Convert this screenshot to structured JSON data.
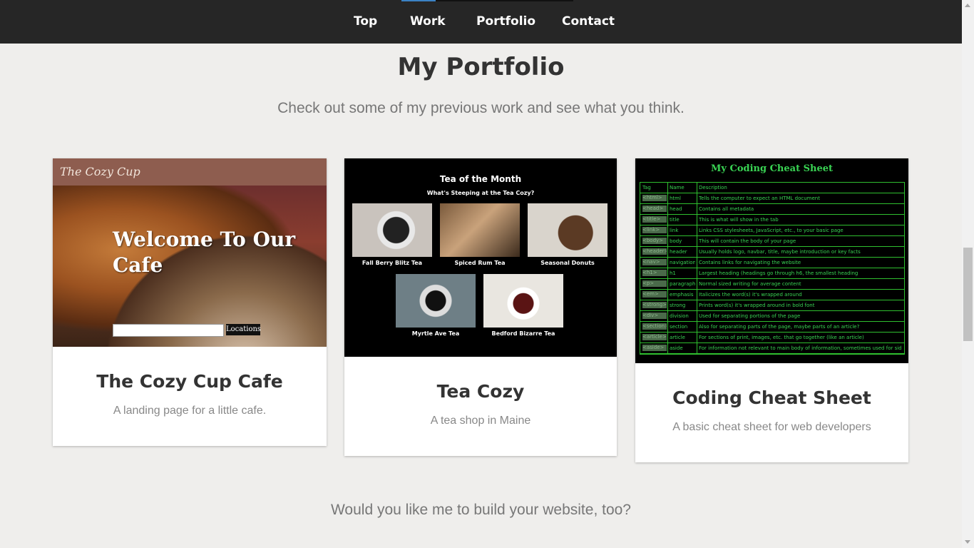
{
  "nav": {
    "items": [
      {
        "label": "Top"
      },
      {
        "label": "Work"
      },
      {
        "label": "Portfolio"
      },
      {
        "label": "Contact"
      }
    ]
  },
  "section": {
    "title": "My Portfolio",
    "subtitle": "Check out some of my previous work and see what you think."
  },
  "cards": [
    {
      "title": "The Cozy Cup Cafe",
      "description": "A landing page for a little cafe.",
      "thumb": {
        "logo": "The Cozy Cup",
        "welcome": "Welcome To Our Cafe",
        "button": "Locations"
      }
    },
    {
      "title": "Tea Cozy",
      "description": "A tea shop in Maine",
      "thumb": {
        "title": "Tea of the Month",
        "subtitle": "What's Steeping at the Tea Cozy?",
        "items": [
          "Fall Berry Blitz Tea",
          "Spiced Rum Tea",
          "Seasonal Donuts",
          "Myrtle Ave Tea",
          "Bedford Bizarre Tea"
        ]
      }
    },
    {
      "title": "Coding Cheat Sheet",
      "description": "A basic cheat sheet for web developers",
      "thumb": {
        "title": "My Coding Cheat Sheet",
        "header": [
          "Tag",
          "Name",
          "Description"
        ],
        "rows": [
          [
            "<html>",
            "html",
            "Tells the computer to expect an HTML document"
          ],
          [
            "<head>",
            "head",
            "Contains all metadata"
          ],
          [
            "<title>",
            "title",
            "This is what will show in the tab"
          ],
          [
            "<link>",
            "link",
            "Links CSS stylesheets, JavaScript, etc., to your basic page"
          ],
          [
            "<body>",
            "body",
            "This will contain the body of your page"
          ],
          [
            "<header>",
            "header",
            "Usually holds logo, navbar, title, maybe introduction or key facts"
          ],
          [
            "<nav>",
            "navigation",
            "Contains links for navigating the website"
          ],
          [
            "<h1>",
            "h1",
            "Largest heading (headings go through h6, the smallest heading"
          ],
          [
            "<p>",
            "paragraph",
            "Normal sized writing for average content"
          ],
          [
            "<em>",
            "emphasis",
            "Italicizes the word(s) it's wrapped around"
          ],
          [
            "<strong>",
            "strong",
            "Prints word(s) it's wrapped around in bold font"
          ],
          [
            "<div>",
            "division",
            "Used for separating portions of the page"
          ],
          [
            "<section>",
            "section",
            "Also for separating parts of the page, maybe parts of an article?"
          ],
          [
            "<article>",
            "article",
            "For sections of print, images, etc. that go together (like an article)"
          ],
          [
            "<aside>",
            "aside",
            "For information not relevant to main body of information, sometimes used for sidenav"
          ]
        ]
      }
    }
  ],
  "cta": "Would you like me to build your website, too?",
  "colors": {
    "nav_bg": "#262626",
    "accent": "#3b82c4",
    "page_bg": "#efeeec",
    "cheat_green": "#39d353"
  }
}
